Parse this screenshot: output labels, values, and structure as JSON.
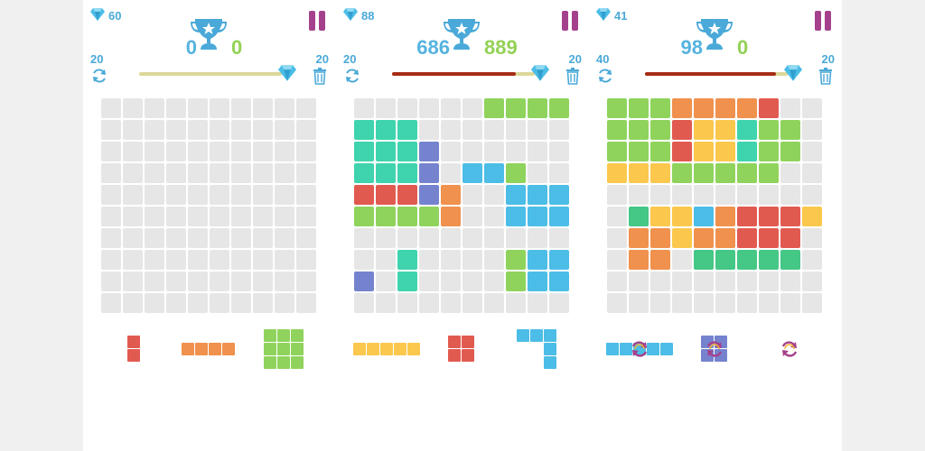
{
  "colors": {
    "empty": "#e6e6e6",
    "accent": "#4aa9d8",
    "pause": "#a5418c",
    "scoreBlue": "#55b3e0",
    "scoreGreen": "#93d156",
    "barTrack": "#ddd89a",
    "barFill": "#a62c15",
    "rotate": "#a5418c",
    "rotateArrow": "#f2b733",
    "palette": {
      "G": "#8fd35c",
      "T": "#3fd3ae",
      "V": "#7583cf",
      "B": "#4cbde6",
      "R": "#e15a50",
      "O": "#f0914d",
      "Y": "#fbc84d",
      "M": "#45c786",
      ".": "#e6e6e6"
    }
  },
  "screens": [
    {
      "gems": "60",
      "score": "0",
      "best": "0",
      "left_num": "20",
      "right_num": "20",
      "progress": 0.0,
      "board": [
        "..........",
        "..........",
        "..........",
        "..........",
        "..........",
        "..........",
        "..........",
        "..........",
        "..........",
        ".........."
      ],
      "pieces": [
        {
          "name": "red-vertical-2",
          "color": "R",
          "shape": [
            "X",
            "X"
          ]
        },
        {
          "name": "orange-horizontal-4",
          "color": "O",
          "shape": [
            "XXXX"
          ]
        },
        {
          "name": "green-square-3x3",
          "color": "G",
          "shape": [
            "XXX",
            "XXX",
            "XXX"
          ]
        }
      ]
    },
    {
      "gems": "88",
      "score": "686",
      "best": "889",
      "left_num": "20",
      "right_num": "20",
      "progress": 0.87,
      "board": [
        "......GGGG",
        "TTT.......",
        "TTTV......",
        "TTTV.BBG..",
        "RRRVO..BBB",
        "GGGGO..BBB",
        "..........",
        "..T....GBB",
        "V.T....GBB",
        ".........."
      ],
      "pieces": [
        {
          "name": "yellow-horizontal-5",
          "color": "Y",
          "shape": [
            "XXXXX"
          ]
        },
        {
          "name": "red-square-2x2",
          "color": "R",
          "shape": [
            "XX",
            "XX"
          ]
        },
        {
          "name": "blue-corner-3x3",
          "color": "B",
          "shape": [
            "XXX",
            "..X",
            "..X"
          ]
        }
      ]
    },
    {
      "gems": "41",
      "score": "98",
      "best": "0",
      "left_num": "40",
      "right_num": "20",
      "progress": 0.92,
      "board": [
        "GGGOOOOR..",
        "GGGRYYTGG.",
        "GGGRYYTGG.",
        "YYYGGGGG..",
        "..........",
        ".MYYBORRRY",
        ".OOYOORRR.",
        ".OO.MMMMM.",
        "..........",
        ".........."
      ],
      "pieces": [
        {
          "name": "blue-horizontal-5",
          "color": "B",
          "shape": [
            "XXXXX"
          ],
          "rotate": true
        },
        {
          "name": "violet-square-2x2",
          "color": "V",
          "shape": [
            "XX",
            "XX"
          ],
          "rotate": true
        },
        {
          "name": "empty-slot",
          "color": "V",
          "shape": [],
          "rotate": true
        }
      ]
    }
  ]
}
